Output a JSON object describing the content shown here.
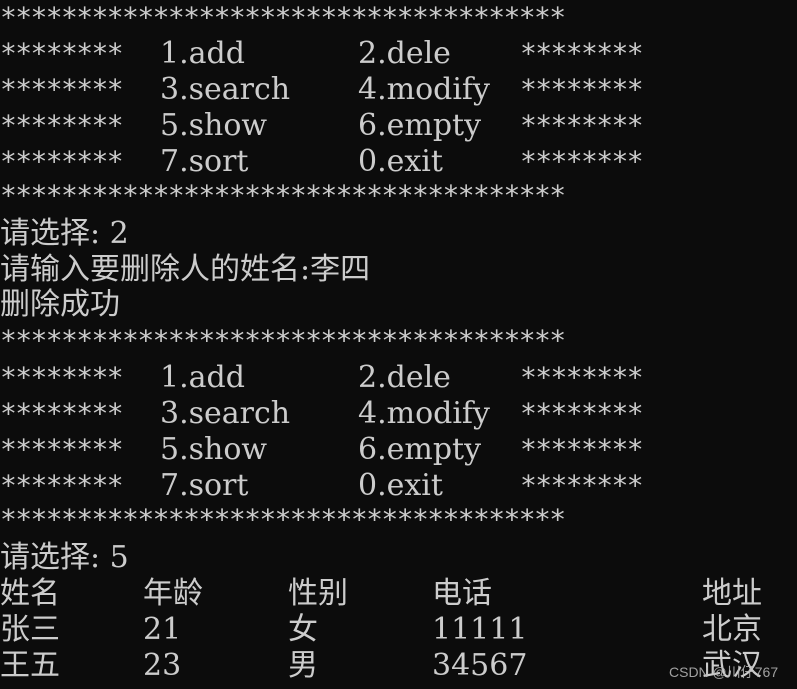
{
  "border": "*************************************",
  "side": "********",
  "menu": [
    [
      "1.add",
      "2.dele"
    ],
    [
      "3.search",
      "4.modify"
    ],
    [
      "5.show",
      "6.empty"
    ],
    [
      "7.sort",
      "0.exit"
    ]
  ],
  "session": {
    "prompt1": "请选择: 2",
    "prompt_name": "请输入要删除人的姓名:李四",
    "result": "删除成功",
    "prompt2": "请选择: 5"
  },
  "table": {
    "headers": [
      "姓名",
      "年龄",
      "性别",
      "电话",
      "地址"
    ],
    "rows": [
      [
        "张三",
        "21",
        "女",
        "11111",
        "北京"
      ],
      [
        "王五",
        "23",
        "男",
        "34567",
        "武汉"
      ]
    ]
  },
  "watermark": "CSDN @川仔767"
}
